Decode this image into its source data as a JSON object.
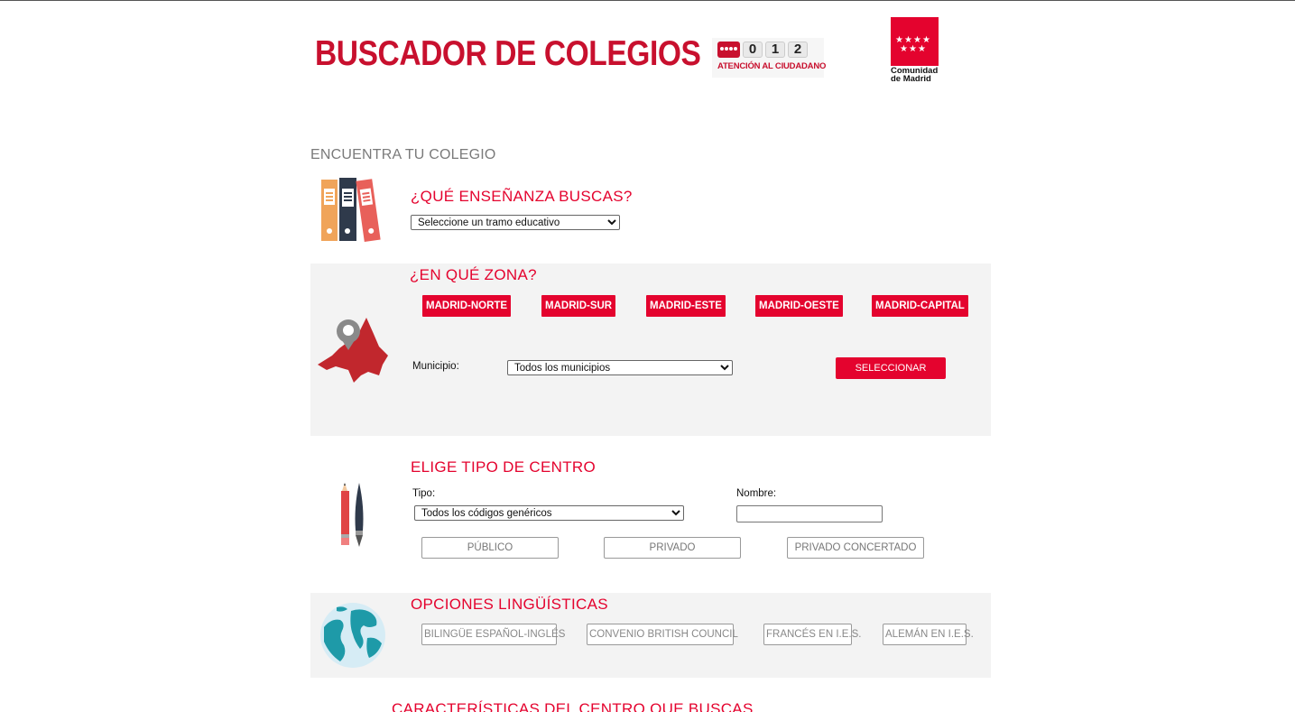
{
  "header": {
    "title": "BUSCADOR DE COLEGIOS",
    "badge": {
      "digits": [
        "0",
        "1",
        "2"
      ],
      "caption": "ATENCIÓN AL CIUDADANO"
    },
    "logo": {
      "stars": "★ ★ ★ ★\n★ ★ ★",
      "text_line1": "Comunidad",
      "text_line2": "de Madrid"
    }
  },
  "subtitle": "ENCUENTRA TU COLEGIO",
  "ensenanza": {
    "title": "¿QUÉ ENSEÑANZA BUSCAS?",
    "select_value": "Seleccione un tramo educativo"
  },
  "zona": {
    "title": "¿EN QUÉ ZONA?",
    "zones": [
      "MADRID-NORTE",
      "MADRID-SUR",
      "MADRID-ESTE",
      "MADRID-OESTE",
      "MADRID-CAPITAL"
    ],
    "municipio_label": "Municipio:",
    "municipio_value": "Todos los municipios",
    "select_button": "SELECCIONAR"
  },
  "tipo": {
    "title": "ELIGE TIPO DE CENTRO",
    "tipo_label": "Tipo:",
    "tipo_value": "Todos los códigos genéricos",
    "nombre_label": "Nombre:",
    "nombre_value": "",
    "buttons": [
      "PÚBLICO",
      "PRIVADO",
      "PRIVADO CONCERTADO"
    ]
  },
  "linguistica": {
    "title": "OPCIONES LINGÜÍSTICAS",
    "buttons": [
      "BILINGÜE ESPAÑOL-INGLÉS",
      "CONVENIO BRITISH COUNCIL",
      "FRANCÉS EN I.E.S.",
      "ALEMÁN EN I.E.S."
    ]
  },
  "caracteristicas": {
    "title": "CARACTERÍSTICAS DEL CENTRO QUE BUSCAS"
  },
  "colors": {
    "brand_red": "#e4032e",
    "title_red": "#c8102e",
    "section_bg": "#f3f3f3"
  }
}
